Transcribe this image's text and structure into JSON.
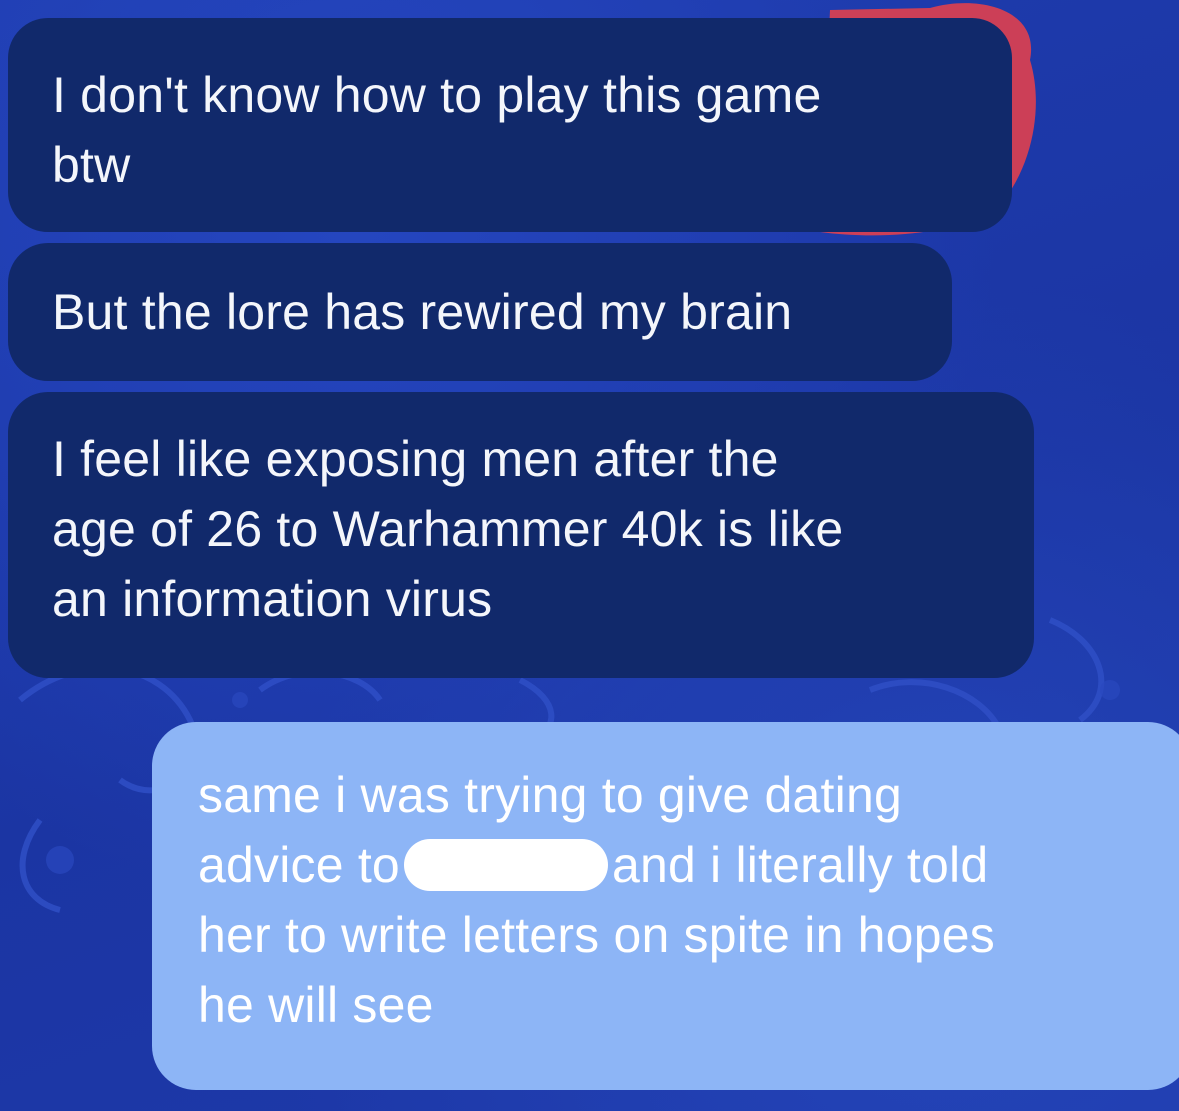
{
  "conversation": {
    "messages": [
      {
        "direction": "incoming",
        "lines": [
          "I don't know how to play this game",
          "btw"
        ]
      },
      {
        "direction": "incoming",
        "lines": [
          "But the lore has rewired my brain"
        ]
      },
      {
        "direction": "incoming",
        "lines": [
          "I feel like exposing men after the",
          "age of 26 to Warhammer 40k is like",
          "an information virus"
        ]
      },
      {
        "direction": "outgoing",
        "lines": [
          "same i was trying to give dating",
          "advice to",
          "and i literally told",
          "her to write letters on spite in hopes",
          "he will see"
        ]
      }
    ]
  },
  "colors": {
    "background": "#1d39a8",
    "incoming_bubble": "#11296b",
    "outgoing_bubble": "#8db5f6",
    "redaction": "#ffffff",
    "wallpaper_accent": "#e0404e"
  }
}
